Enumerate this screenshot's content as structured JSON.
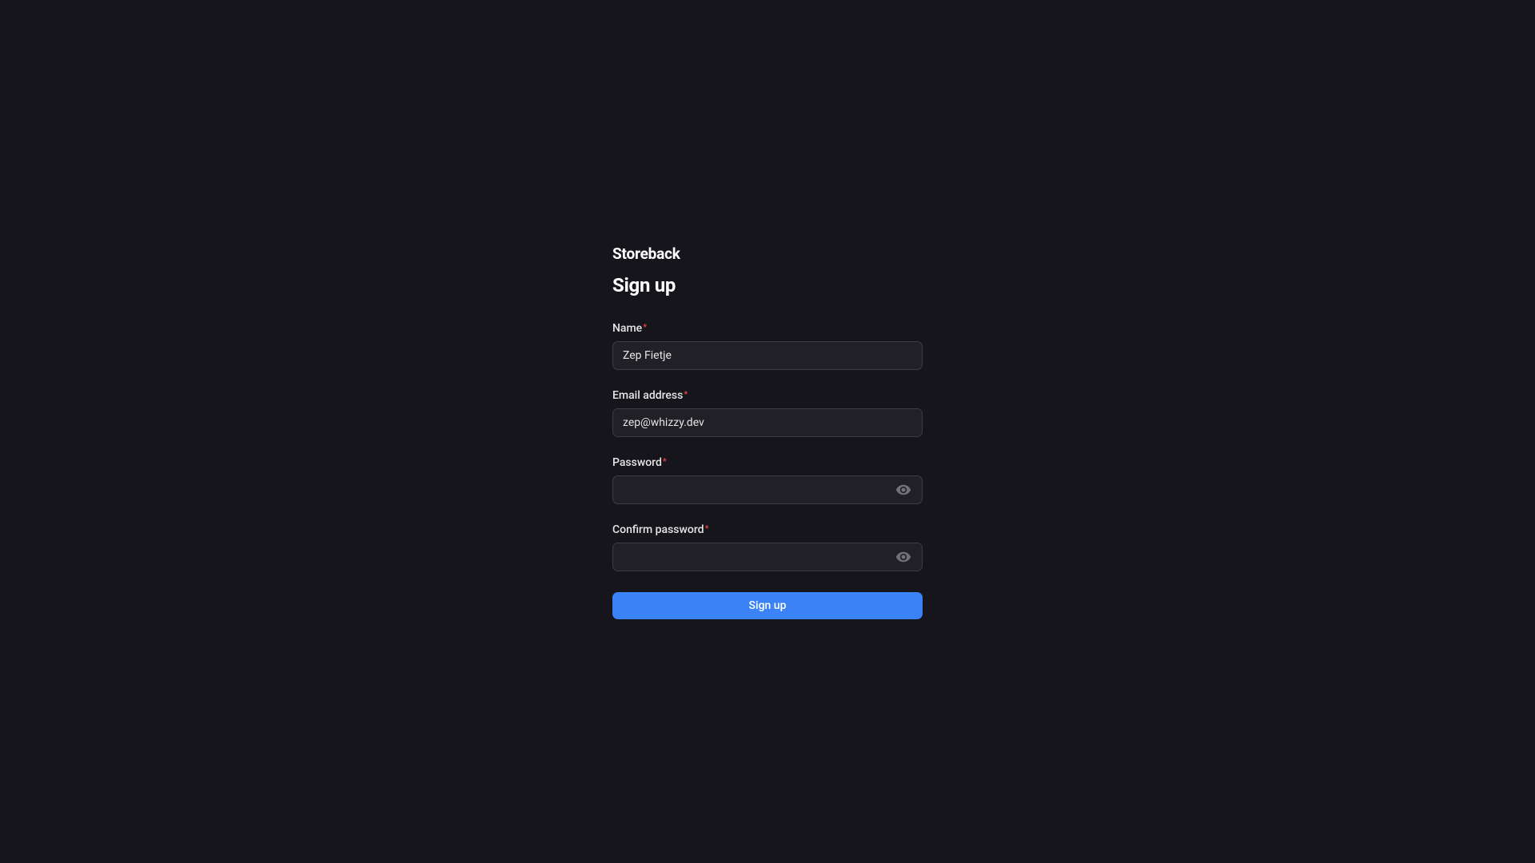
{
  "brand": "Storeback",
  "heading": "Sign up",
  "fields": {
    "name": {
      "label": "Name",
      "value": "Zep Fietje",
      "required": true
    },
    "email": {
      "label": "Email address",
      "value": "zep@whizzy.dev",
      "required": true
    },
    "password": {
      "label": "Password",
      "value": "",
      "required": true
    },
    "confirm_password": {
      "label": "Confirm password",
      "value": "",
      "required": true
    }
  },
  "submit_label": "Sign up",
  "required_marker": "*"
}
